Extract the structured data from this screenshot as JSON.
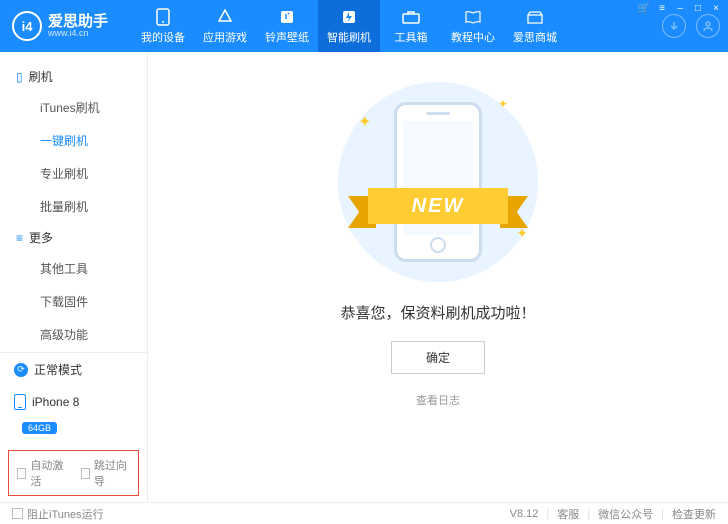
{
  "app": {
    "name": "爱思助手",
    "site": "www.i4.cn",
    "logo_text": "i4"
  },
  "nav": [
    {
      "label": "我的设备",
      "icon": "phone"
    },
    {
      "label": "应用游戏",
      "icon": "apps"
    },
    {
      "label": "铃声壁纸",
      "icon": "music"
    },
    {
      "label": "智能刷机",
      "icon": "flash",
      "active": true
    },
    {
      "label": "工具箱",
      "icon": "toolbox"
    },
    {
      "label": "教程中心",
      "icon": "book"
    },
    {
      "label": "爱思商城",
      "icon": "shop"
    }
  ],
  "sidebar": {
    "section1": {
      "title": "刷机",
      "items": [
        "iTunes刷机",
        "一键刷机",
        "专业刷机",
        "批量刷机"
      ],
      "active_index": 1
    },
    "section2": {
      "title": "更多",
      "items": [
        "其他工具",
        "下载固件",
        "高级功能"
      ]
    },
    "mode": "正常模式",
    "device": {
      "name": "iPhone 8",
      "storage": "64GB"
    },
    "checks": {
      "auto_activate": "自动激活",
      "skip_guide": "跳过向导"
    }
  },
  "main": {
    "ribbon": "NEW",
    "success": "恭喜您，保资料刷机成功啦！",
    "ok": "确定",
    "log": "查看日志"
  },
  "footer": {
    "block_itunes": "阻止iTunes运行",
    "version": "V8.12",
    "support": "客服",
    "wechat": "微信公众号",
    "update": "检查更新"
  }
}
